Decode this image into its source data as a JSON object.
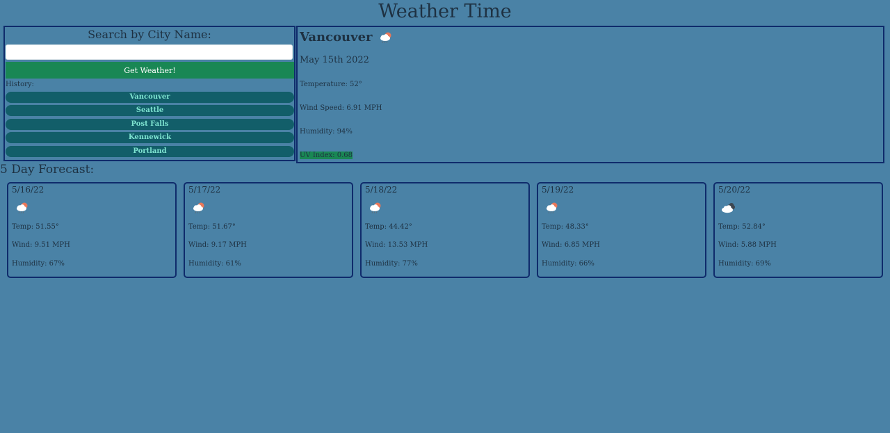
{
  "header": {
    "title": "Weather Time"
  },
  "search": {
    "heading": "Search by City Name:",
    "input_value": "",
    "button_label": "Get Weather!",
    "history_label": "History:",
    "history": [
      "Vancouver",
      "Seattle",
      "Post Falls",
      "Kennewick",
      "Portland"
    ]
  },
  "current": {
    "city": "Vancouver",
    "icon": "rain-cloud-sun-icon",
    "date": "May 15th 2022",
    "temperature": "Temperature: 52°",
    "wind": "Wind Speed: 6.91 MPH",
    "humidity": "Humidity: 94%",
    "uv_index": "UV Index: 0.68",
    "uv_color": "#198754"
  },
  "forecast": {
    "title": "5 Day Forecast:",
    "days": [
      {
        "date": "5/16/22",
        "icon": "rain-cloud-sun-icon",
        "temp": "Temp: 51.55°",
        "wind": "Wind: 9.51 MPH",
        "humidity": "Humidity: 67%"
      },
      {
        "date": "5/17/22",
        "icon": "rain-cloud-sun-icon",
        "temp": "Temp: 51.67°",
        "wind": "Wind: 9.17 MPH",
        "humidity": "Humidity: 61%"
      },
      {
        "date": "5/18/22",
        "icon": "rain-cloud-sun-icon",
        "temp": "Temp: 44.42°",
        "wind": "Wind: 13.53 MPH",
        "humidity": "Humidity: 77%"
      },
      {
        "date": "5/19/22",
        "icon": "rain-cloud-sun-icon",
        "temp": "Temp: 48.33°",
        "wind": "Wind: 6.85 MPH",
        "humidity": "Humidity: 66%"
      },
      {
        "date": "5/20/22",
        "icon": "broken-clouds-icon",
        "temp": "Temp: 52.84°",
        "wind": "Wind: 5.88 MPH",
        "humidity": "Humidity: 69%"
      }
    ]
  },
  "colors": {
    "background": "#4a82a6",
    "panel_border": "#0f2b6b",
    "primary_button": "#198754",
    "history_button": "#125e69",
    "history_text": "#7ee3d0"
  }
}
